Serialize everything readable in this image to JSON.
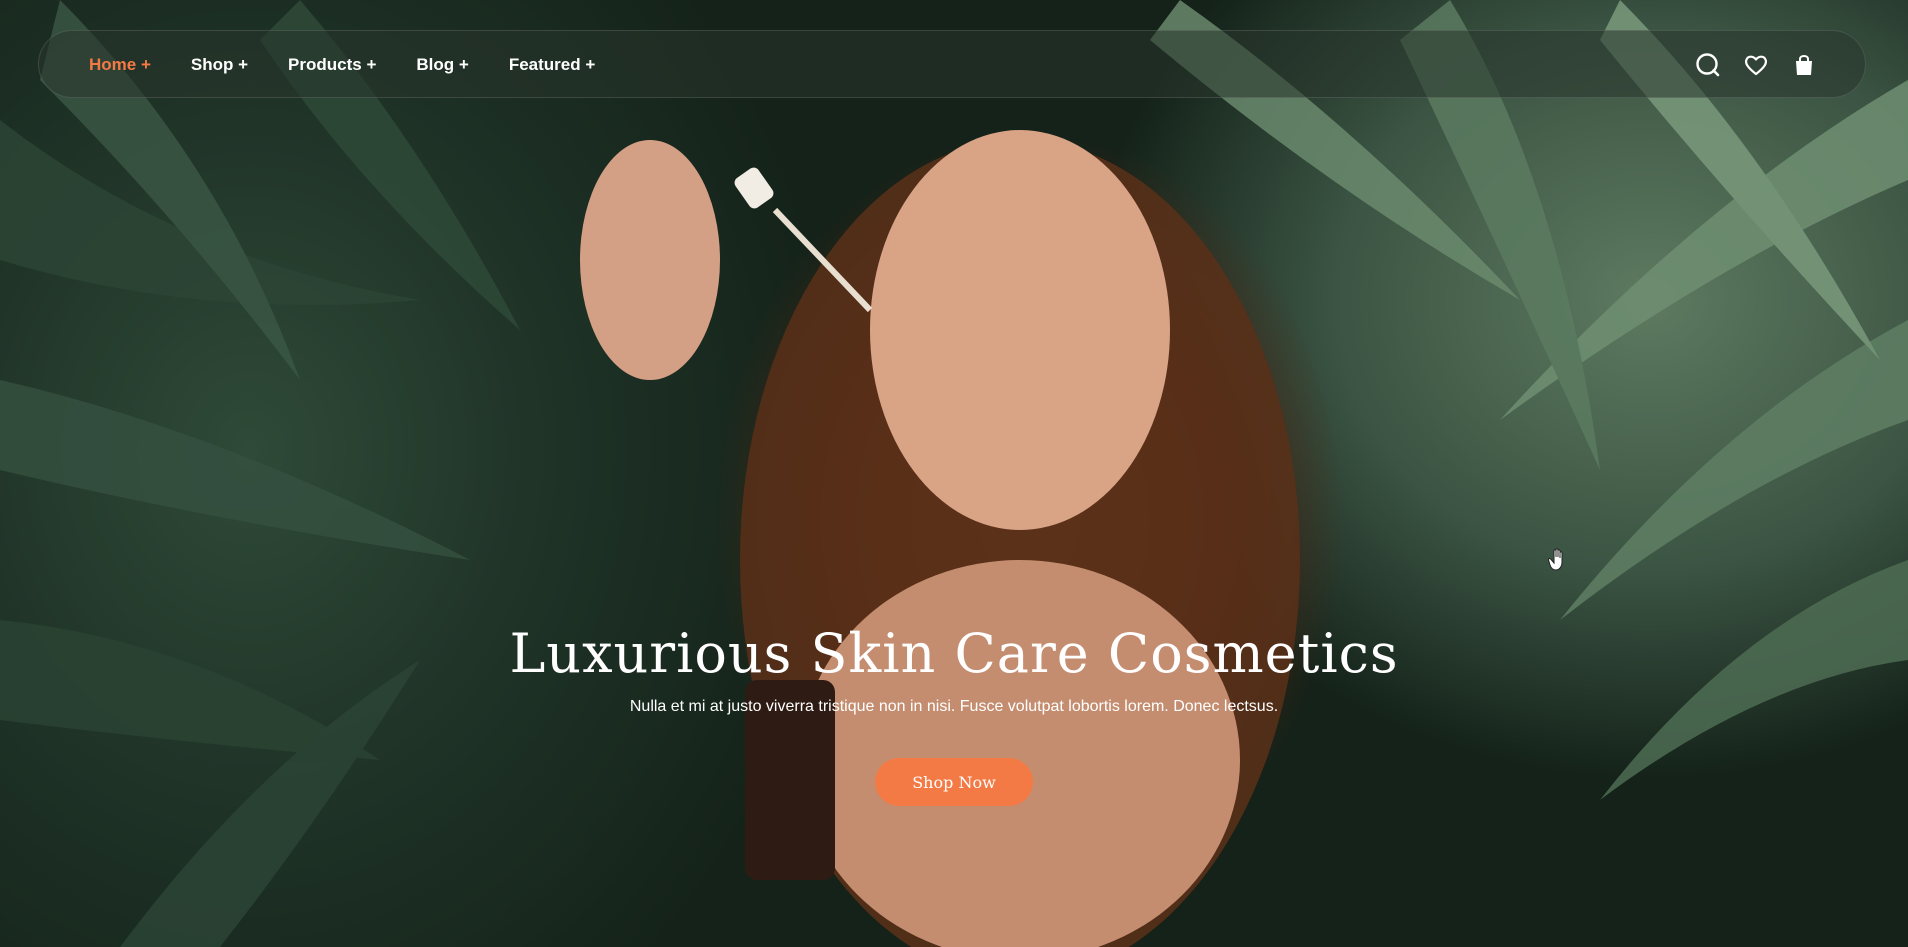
{
  "nav": {
    "links": [
      {
        "label": "Home +",
        "active": true
      },
      {
        "label": "Shop +",
        "active": false
      },
      {
        "label": "Products +",
        "active": false
      },
      {
        "label": "Blog +",
        "active": false
      },
      {
        "label": "Featured +",
        "active": false
      }
    ],
    "icons": [
      "search-icon",
      "heart-icon",
      "shopping-bag-icon"
    ]
  },
  "hero": {
    "title": "Luxurious Skin Care Cosmetics",
    "subtitle": "Nulla et mi at justo viverra tristique non in nisi. Fusce volutpat lobortis lorem. Donec lectsus.",
    "cta_label": "Shop Now"
  },
  "colors": {
    "accent": "#f47a45",
    "text": "#ffffff"
  }
}
